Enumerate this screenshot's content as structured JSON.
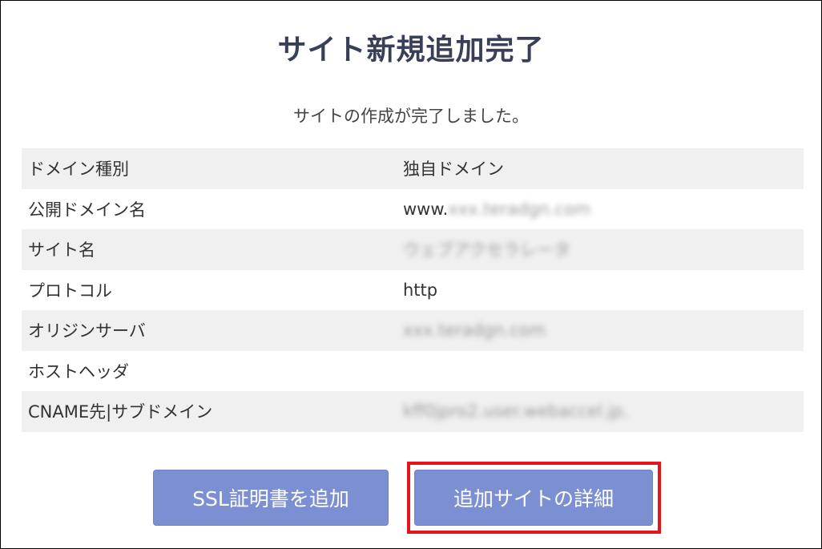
{
  "page": {
    "title": "サイト新規追加完了",
    "message": "サイトの作成が完了しました。"
  },
  "table": {
    "rows": [
      {
        "label": "ドメイン種別",
        "value": "独自ドメイン",
        "blur": ""
      },
      {
        "label": "公開ドメイン名",
        "value": "www.",
        "blur": "xxx.teradgn.com"
      },
      {
        "label": "サイト名",
        "value": "",
        "blur": "ウェブアクセラレータ"
      },
      {
        "label": "プロトコル",
        "value": "http",
        "blur": ""
      },
      {
        "label": "オリジンサーバ",
        "value": "",
        "blur": "xxx.teradgn.com"
      },
      {
        "label": "ホストヘッダ",
        "value": "",
        "blur": ""
      },
      {
        "label": "CNAME先|サブドメイン",
        "value": "",
        "blur": "kff0jpro2.user.webaccel.jp."
      }
    ]
  },
  "buttons": {
    "ssl_label": "SSL証明書を追加",
    "detail_label": "追加サイトの詳細"
  },
  "colors": {
    "button": "#7c8fd2",
    "highlight": "#e3151a",
    "title": "#3a3f58"
  }
}
